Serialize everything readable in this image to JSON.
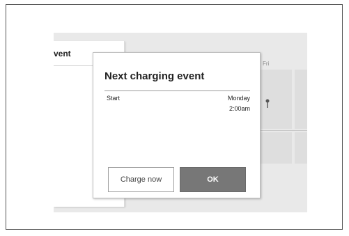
{
  "background": {
    "panel_title": "vent",
    "day_label": "Fri"
  },
  "dialog": {
    "title": "Next charging event",
    "row": {
      "label": "Start",
      "day": "Monday",
      "time": "2:00am"
    },
    "buttons": {
      "secondary": "Charge now",
      "primary": "OK"
    }
  },
  "colors": {
    "primary_button": "#777777",
    "screen_background": "#e9e9e9"
  }
}
